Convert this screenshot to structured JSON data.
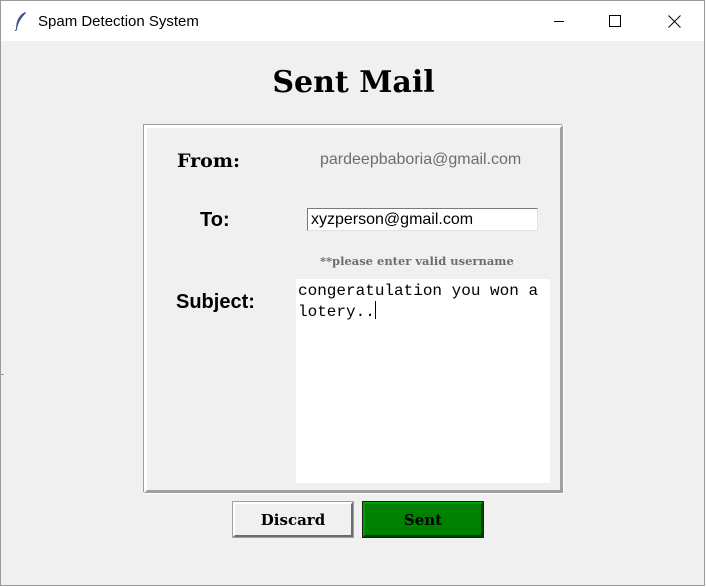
{
  "window": {
    "title": "Spam Detection System",
    "controls": {
      "minimize_icon": "minimize-icon",
      "maximize_icon": "maximize-icon",
      "close_icon": "close-icon"
    }
  },
  "page": {
    "heading": "Sent Mail"
  },
  "form": {
    "from_label": "From:",
    "from_value": "pardeepbaboria@gmail.com",
    "to_label": "To:",
    "to_value": "xyzperson@gmail.com",
    "hint": "**please enter valid username",
    "subject_label": "Subject:",
    "subject_value": "congeratulation you won a lotery.."
  },
  "buttons": {
    "discard_label": "Discard",
    "sent_label": "Sent"
  },
  "colors": {
    "window_bg": "#f0f0f0",
    "sent_button": "#008000",
    "muted_text": "#6d6d6d"
  }
}
